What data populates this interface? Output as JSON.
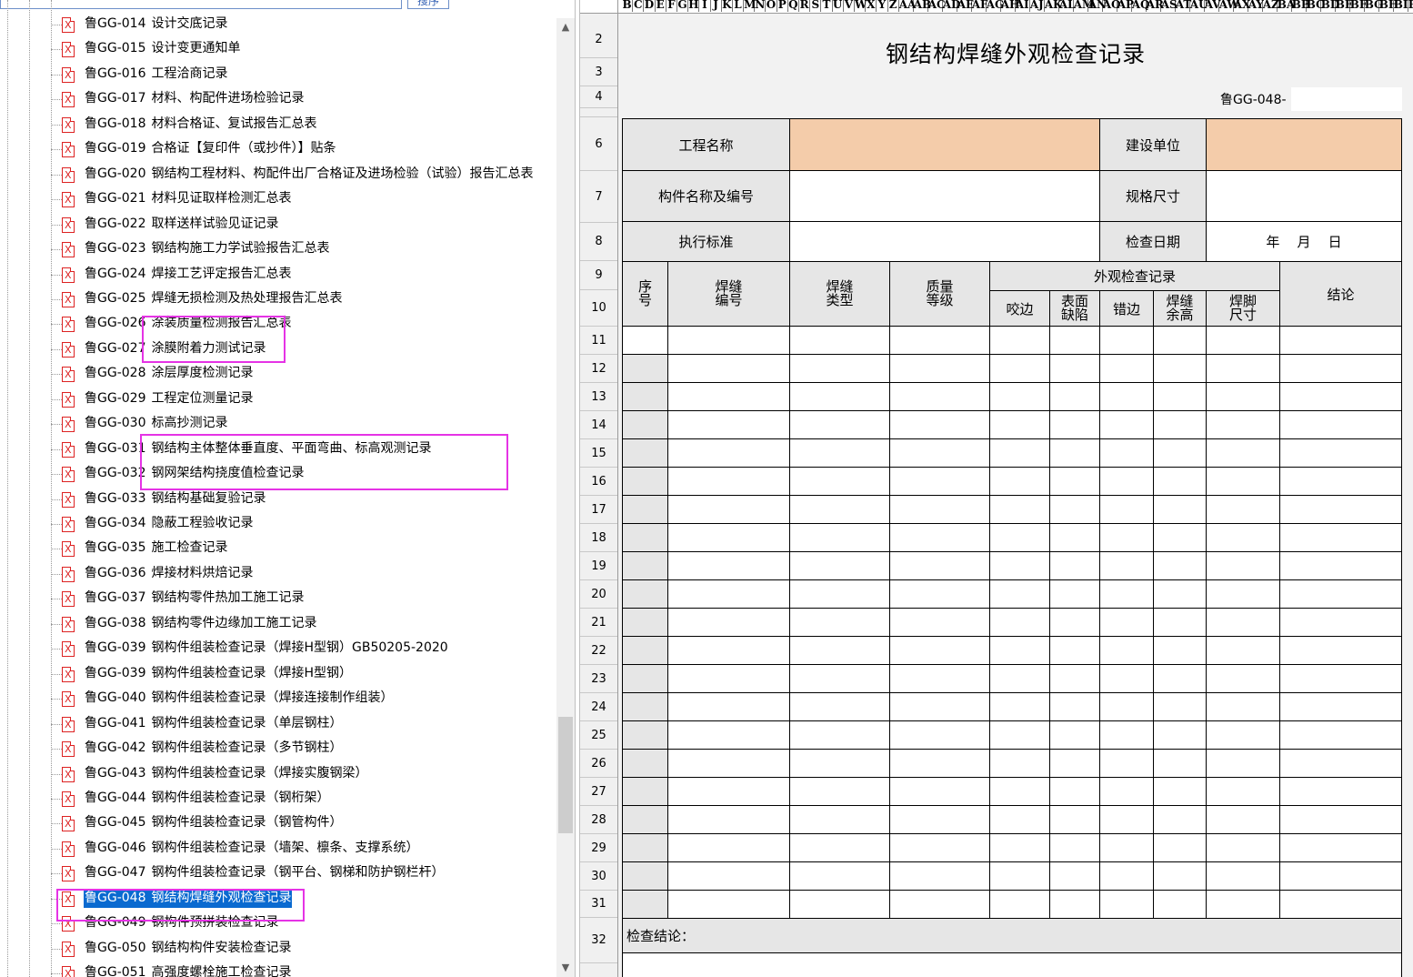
{
  "toolbar": {
    "search_button_label": "搜序"
  },
  "tree": {
    "items": [
      {
        "code": "鲁GG-014",
        "title": "设计交底记录"
      },
      {
        "code": "鲁GG-015",
        "title": "设计变更通知单"
      },
      {
        "code": "鲁GG-016",
        "title": "工程洽商记录"
      },
      {
        "code": "鲁GG-017",
        "title": "材料、构配件进场检验记录"
      },
      {
        "code": "鲁GG-018",
        "title": "材料合格证、复试报告汇总表"
      },
      {
        "code": "鲁GG-019",
        "title": "合格证【复印件（或抄件）】贴条"
      },
      {
        "code": "鲁GG-020",
        "title": "钢结构工程材料、构配件出厂合格证及进场检验（试验）报告汇总表"
      },
      {
        "code": "鲁GG-021",
        "title": "材料见证取样检测汇总表"
      },
      {
        "code": "鲁GG-022",
        "title": "取样送样试验见证记录"
      },
      {
        "code": "鲁GG-023",
        "title": "钢结构施工力学试验报告汇总表"
      },
      {
        "code": "鲁GG-024",
        "title": "焊接工艺评定报告汇总表"
      },
      {
        "code": "鲁GG-025",
        "title": "焊缝无损检测及热处理报告汇总表"
      },
      {
        "code": "鲁GG-026",
        "title": "涂装质量检测报告汇总表"
      },
      {
        "code": "鲁GG-027",
        "title": "涂膜附着力测试记录"
      },
      {
        "code": "鲁GG-028",
        "title": "涂层厚度检测记录"
      },
      {
        "code": "鲁GG-029",
        "title": "工程定位测量记录"
      },
      {
        "code": "鲁GG-030",
        "title": "标高抄测记录"
      },
      {
        "code": "鲁GG-031",
        "title": "钢结构主体整体垂直度、平面弯曲、标高观测记录"
      },
      {
        "code": "鲁GG-032",
        "title": "钢网架结构挠度值检查记录"
      },
      {
        "code": "鲁GG-033",
        "title": "钢结构基础复验记录"
      },
      {
        "code": "鲁GG-034",
        "title": "隐蔽工程验收记录"
      },
      {
        "code": "鲁GG-035",
        "title": "施工检查记录"
      },
      {
        "code": "鲁GG-036",
        "title": "焊接材料烘焙记录"
      },
      {
        "code": "鲁GG-037",
        "title": "钢结构零件热加工施工记录"
      },
      {
        "code": "鲁GG-038",
        "title": "钢结构零件边缘加工施工记录"
      },
      {
        "code": "鲁GG-039",
        "title": "钢构件组装检查记录（焊接H型钢）GB50205-2020"
      },
      {
        "code": "鲁GG-039",
        "title": "钢构件组装检查记录（焊接H型钢）"
      },
      {
        "code": "鲁GG-040",
        "title": "钢构件组装检查记录（焊接连接制作组装）"
      },
      {
        "code": "鲁GG-041",
        "title": "钢构件组装检查记录（单层钢柱）"
      },
      {
        "code": "鲁GG-042",
        "title": "钢构件组装检查记录（多节钢柱）"
      },
      {
        "code": "鲁GG-043",
        "title": "钢构件组装检查记录（焊接实腹钢梁）"
      },
      {
        "code": "鲁GG-044",
        "title": "钢构件组装检查记录（钢桁架）"
      },
      {
        "code": "鲁GG-045",
        "title": "钢构件组装检查记录（钢管构件）"
      },
      {
        "code": "鲁GG-046",
        "title": "钢构件组装检查记录（墙架、檩条、支撑系统）"
      },
      {
        "code": "鲁GG-047",
        "title": "钢构件组装检查记录（钢平台、钢梯和防护钢栏杆）"
      },
      {
        "code": "鲁GG-048",
        "title": "钢结构焊缝外观检查记录"
      },
      {
        "code": "鲁GG-049",
        "title": "钢构件预拼装检查记录"
      },
      {
        "code": "鲁GG-050",
        "title": "钢结构构件安装检查记录"
      },
      {
        "code": "鲁GG-051",
        "title": "高强度螺栓施工检查记录"
      }
    ]
  },
  "sheet": {
    "column_letters": [
      "B",
      "C",
      "D",
      "E",
      "F",
      "G",
      "H",
      "I",
      "J",
      "K",
      "L",
      "M",
      "N",
      "O",
      "P",
      "Q",
      "R",
      "S",
      "T",
      "U",
      "V",
      "W",
      "X",
      "Y",
      "Z",
      "AA",
      "AB",
      "AC",
      "AD",
      "AE",
      "AF",
      "AG",
      "AH",
      "AI",
      "AJ",
      "AK",
      "AL",
      "AM",
      "AN",
      "AO",
      "AP",
      "AQ",
      "AR",
      "AS",
      "AT",
      "AU",
      "AV",
      "AW",
      "AX",
      "AY",
      "AZ",
      "BA",
      "BB",
      "BC",
      "BD",
      "BE",
      "BF",
      "BG",
      "BH",
      "BI",
      "BJ",
      "BK",
      "BL"
    ],
    "row_numbers": [
      "2",
      "3",
      "4",
      "6",
      "7",
      "8",
      "9",
      "10",
      "11",
      "12",
      "13",
      "14",
      "15",
      "16",
      "17",
      "18",
      "19",
      "20",
      "21",
      "22",
      "23",
      "24",
      "25",
      "26",
      "27",
      "28",
      "29",
      "30",
      "31",
      "32"
    ],
    "title": "钢结构焊缝外观检查记录",
    "doc_no_label": "鲁GG-048-",
    "labels": {
      "project_name": "工程名称",
      "client": "建设单位",
      "component": "构件名称及编号",
      "spec": "规格尺寸",
      "standard": "执行标准",
      "check_date": "检查日期",
      "date_value": "年    月    日",
      "seq": "序\n号",
      "weld_no": "焊缝\n编号",
      "weld_type": "焊缝\n类型",
      "quality": "质量\n等级",
      "appearance": "外观检查记录",
      "undercut": "咬边",
      "surface_defect": "表面\n缺陷",
      "misalign": "错边",
      "reinforcement": "焊缝\n余高",
      "leg_size": "焊脚\n尺寸",
      "conclusion": "结论",
      "check_conclusion": "检查结论："
    }
  }
}
